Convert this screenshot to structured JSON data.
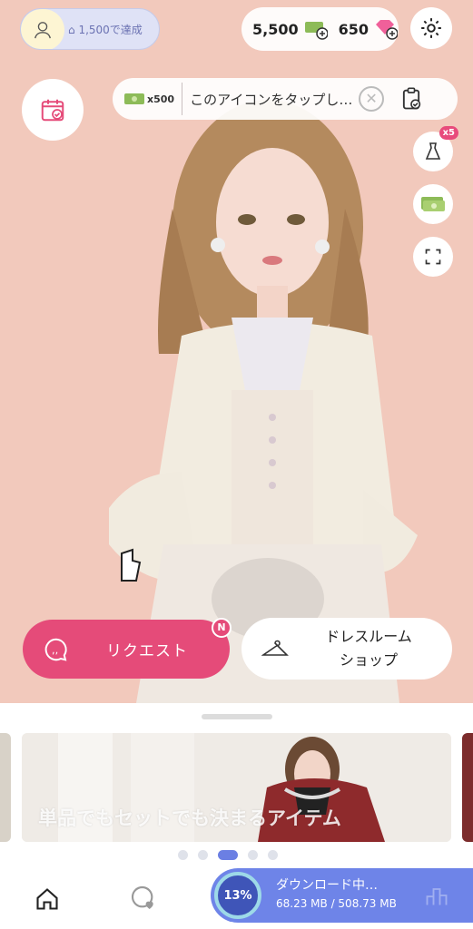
{
  "header": {
    "goal_text": "1,500で達成",
    "currency": {
      "money": "5,500",
      "gems": "650"
    }
  },
  "tip": {
    "amount": "x500",
    "message": "このアイコンをタップし…",
    "close": "⊗"
  },
  "side": {
    "dress_badge": "x5"
  },
  "actions": {
    "request_label": "リクエスト",
    "request_badge": "N",
    "shop_label_1": "ドレスルーム",
    "shop_label_2": "ショップ"
  },
  "banner": {
    "title": "単品でもセットでも決まるアイテム"
  },
  "download": {
    "percent": "13%",
    "status": "ダウンロード中…",
    "size": "68.23 MB / 508.73 MB",
    "progress": 0.13
  },
  "colors": {
    "accent": "#e54b79",
    "download_bg": "#6e84e8",
    "stage_bg": "#f2c9bc"
  }
}
